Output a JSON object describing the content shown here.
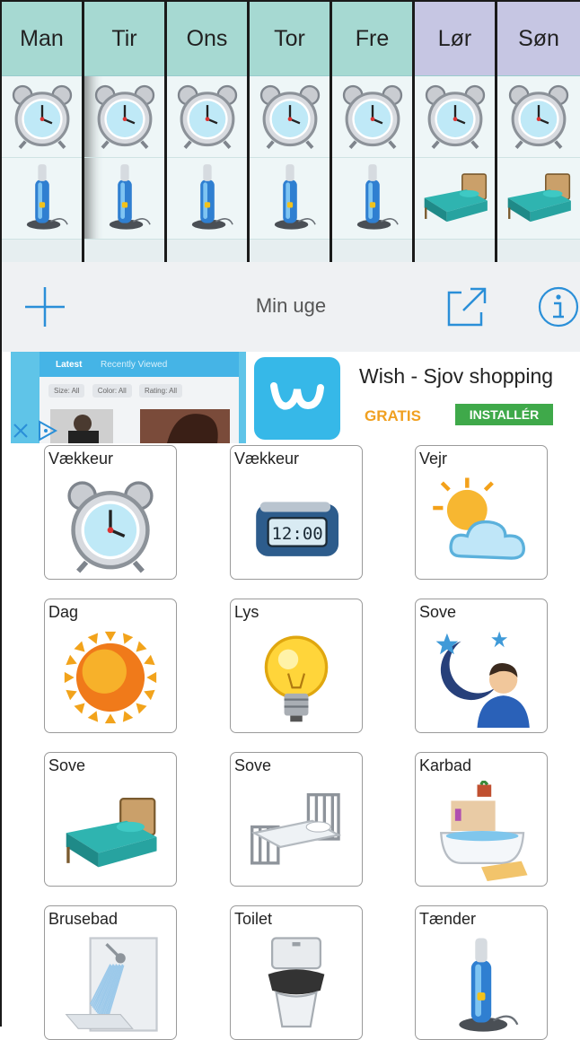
{
  "week": {
    "days": [
      {
        "label": "Man",
        "kind": "weekday"
      },
      {
        "label": "Tir",
        "kind": "weekday"
      },
      {
        "label": "Ons",
        "kind": "weekday"
      },
      {
        "label": "Tor",
        "kind": "weekday"
      },
      {
        "label": "Fre",
        "kind": "weekday"
      },
      {
        "label": "Lør",
        "kind": "weekend"
      },
      {
        "label": "Søn",
        "kind": "weekend"
      }
    ],
    "rows": [
      [
        "alarm-clock-icon",
        "alarm-clock-icon",
        "alarm-clock-icon",
        "alarm-clock-icon",
        "alarm-clock-icon",
        "alarm-clock-icon",
        "alarm-clock-icon"
      ],
      [
        "toothbrush-icon",
        "toothbrush-icon",
        "toothbrush-icon",
        "toothbrush-icon",
        "toothbrush-icon",
        "bed-icon",
        "bed-icon"
      ]
    ],
    "colors": {
      "weekday_header": "#a6d9d2",
      "weekend_header": "#c6c6e3"
    }
  },
  "toolbar": {
    "title": "Min uge",
    "add_icon": "plus-icon",
    "share_icon": "share-icon",
    "info_icon": "info-icon",
    "accent": "#2a8fd8"
  },
  "ad": {
    "app_name": "Wish - Sjov shopping",
    "price": "GRATIS",
    "install_label": "INSTALLÉR",
    "screenshot_tab_latest": "Latest",
    "screenshot_tab_recent": "Recently Viewed",
    "screenshot_chips": [
      "Size: All",
      "Color: All",
      "Rating: All"
    ],
    "logo_icon": "wish-logo-icon",
    "close_icon": "close-icon",
    "adchoices_icon": "adchoices-icon"
  },
  "library": {
    "items": [
      {
        "label": "Vækkeur",
        "icon": "alarm-clock-icon"
      },
      {
        "label": "Vækkeur",
        "icon": "digital-clock-icon"
      },
      {
        "label": "Vejr",
        "icon": "weather-icon"
      },
      {
        "label": "Dag",
        "icon": "sun-icon"
      },
      {
        "label": "Lys",
        "icon": "light-bulb-icon"
      },
      {
        "label": "Sove",
        "icon": "sleep-moon-icon"
      },
      {
        "label": "Sove",
        "icon": "bed-icon"
      },
      {
        "label": "Sove",
        "icon": "metal-bed-icon"
      },
      {
        "label": "Karbad",
        "icon": "bathtub-icon"
      },
      {
        "label": "Brusebad",
        "icon": "shower-icon"
      },
      {
        "label": "Toilet",
        "icon": "toilet-icon"
      },
      {
        "label": "Tænder",
        "icon": "toothbrush-icon"
      }
    ]
  }
}
